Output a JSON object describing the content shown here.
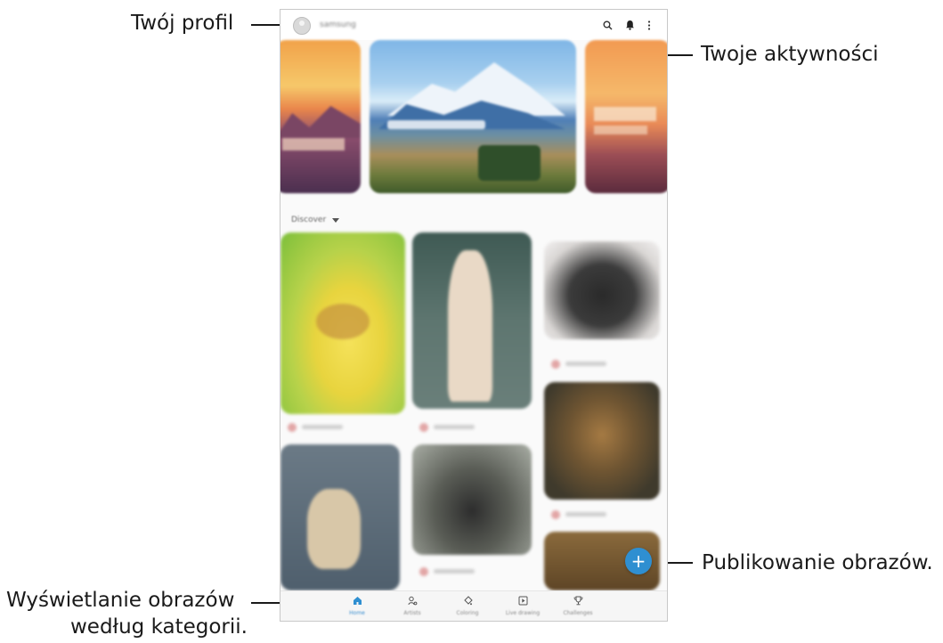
{
  "callouts": {
    "profile": "Twój profil",
    "activity": "Twoje aktywności",
    "publish": "Publikowanie obrazów.",
    "categories_line1": "Wyświetlanie obrazów",
    "categories_line2": "według kategorii."
  },
  "app": {
    "username": "samsung",
    "section_label": "Discover",
    "fab_label": "+",
    "nav": [
      {
        "label": "Home",
        "icon": "home-icon",
        "active": true
      },
      {
        "label": "Artists",
        "icon": "artists-icon",
        "active": false
      },
      {
        "label": "Coloring",
        "icon": "coloring-icon",
        "active": false
      },
      {
        "label": "Live drawing",
        "icon": "live-drawing-icon",
        "active": false
      },
      {
        "label": "Challenges",
        "icon": "challenges-icon",
        "active": false
      }
    ]
  },
  "colors": {
    "accent": "#2f8fd1",
    "callout_text": "#1a1a1a"
  }
}
